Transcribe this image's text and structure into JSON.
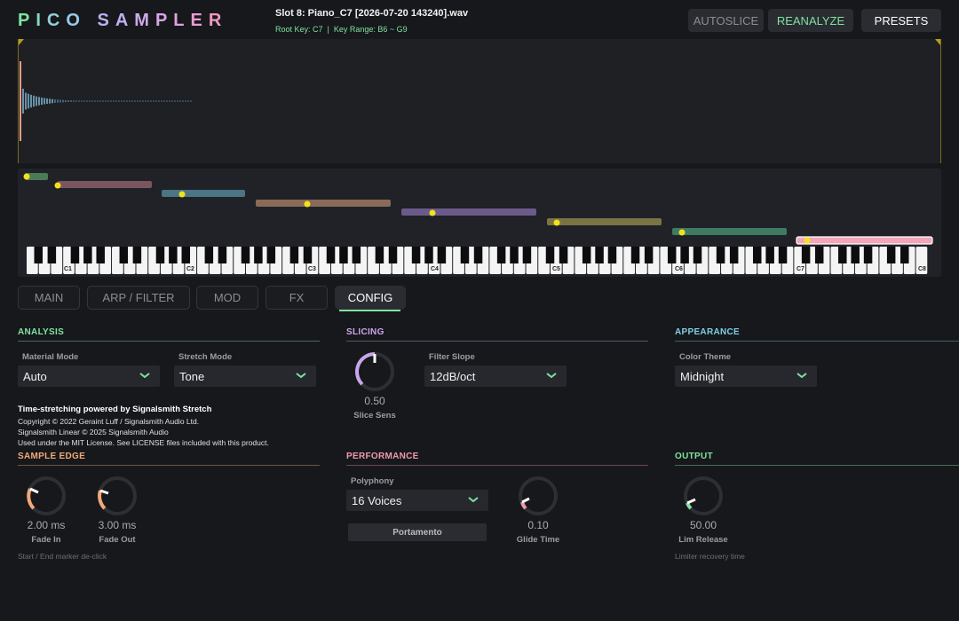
{
  "app": {
    "logo_letters": [
      "P",
      "I",
      "C",
      "O",
      " ",
      "S",
      "A",
      "M",
      "P",
      "L",
      "E",
      "R"
    ],
    "logo_colors": [
      "#7ee3a0",
      "#86d8c0",
      "#8fd0dc",
      "#99c8ea",
      "#ffffff",
      "#b8b2f0",
      "#c2aef0",
      "#ccaaee",
      "#d6a6e6",
      "#e0a2dc",
      "#e89ed0",
      "#ef9ac2"
    ],
    "slot_title": "Slot 8: Piano_C7 [2026-07-20 143240].wav",
    "slot_info": "Root Key: C7  |  Key Range: B6 ~ G9"
  },
  "header_buttons": {
    "autoslice": "AUTOSLICE",
    "reanalyze": "REANALYZE",
    "presets": "PRESETS"
  },
  "keyboard": {
    "octave_labels": [
      "C1",
      "C2",
      "C3",
      "C4",
      "C5",
      "C6",
      "C7",
      "C8"
    ],
    "zones": [
      {
        "color": "#4b7a55",
        "dot": "#f2e21c"
      },
      {
        "color": "#7a5560",
        "dot": "#f2e21c"
      },
      {
        "color": "#4b7585",
        "dot": "#f2e21c"
      },
      {
        "color": "#8a6a58",
        "dot": "#f2e21c"
      },
      {
        "color": "#6b5a8a",
        "dot": "#f2e21c"
      },
      {
        "color": "#7a7444",
        "dot": "#f2e21c"
      },
      {
        "color": "#3f7a62",
        "dot": "#f2e21c"
      },
      {
        "color": "#f2a6b8",
        "dot": "#f2e21c"
      }
    ]
  },
  "tabs": [
    {
      "label": "MAIN",
      "active": false
    },
    {
      "label": "ARP / FILTER",
      "active": false
    },
    {
      "label": "MOD",
      "active": false
    },
    {
      "label": "FX",
      "active": false
    },
    {
      "label": "CONFIG",
      "active": true
    }
  ],
  "analysis": {
    "title": "ANALYSIS",
    "color": "#7ee3a0",
    "material_label": "Material Mode",
    "material_value": "Auto",
    "stretch_label": "Stretch Mode",
    "stretch_value": "Tone"
  },
  "credits": {
    "title": "Time-stretching powered by Signalsmith Stretch",
    "line1": "Copyright © 2022 Geraint Luff / Signalsmith Audio Ltd.",
    "line2": "Signalsmith Linear © 2025 Signalsmith Audio",
    "line3": "Used under the MIT License. See LICENSE files included with this product."
  },
  "slicing": {
    "title": "SLICING",
    "color": "#c9a6ec",
    "knob_value": "0.50",
    "knob_label": "Slice Sens",
    "knob_level": 0.5,
    "filter_label": "Filter Slope",
    "filter_value": "12dB/oct"
  },
  "appearance": {
    "title": "APPEARANCE",
    "color": "#7ecfe3",
    "theme_label": "Color Theme",
    "theme_value": "Midnight"
  },
  "sample_edge": {
    "title": "SAMPLE EDGE",
    "color": "#f2a978",
    "fade_in_value": "2.00 ms",
    "fade_in_label": "Fade In",
    "fade_out_value": "3.00 ms",
    "fade_out_label": "Fade Out",
    "hint": "Start / End marker de-click"
  },
  "performance": {
    "title": "PERFORMANCE",
    "color": "#ef9aae",
    "polyphony_label": "Polyphony",
    "polyphony_value": "16 Voices",
    "portamento_label": "Portamento",
    "glide_value": "0.10",
    "glide_label": "Glide Time"
  },
  "output": {
    "title": "OUTPUT",
    "color": "#7ee3a0",
    "lim_value": "50.00",
    "lim_label": "Lim Release",
    "hint": "Limiter recovery time"
  }
}
